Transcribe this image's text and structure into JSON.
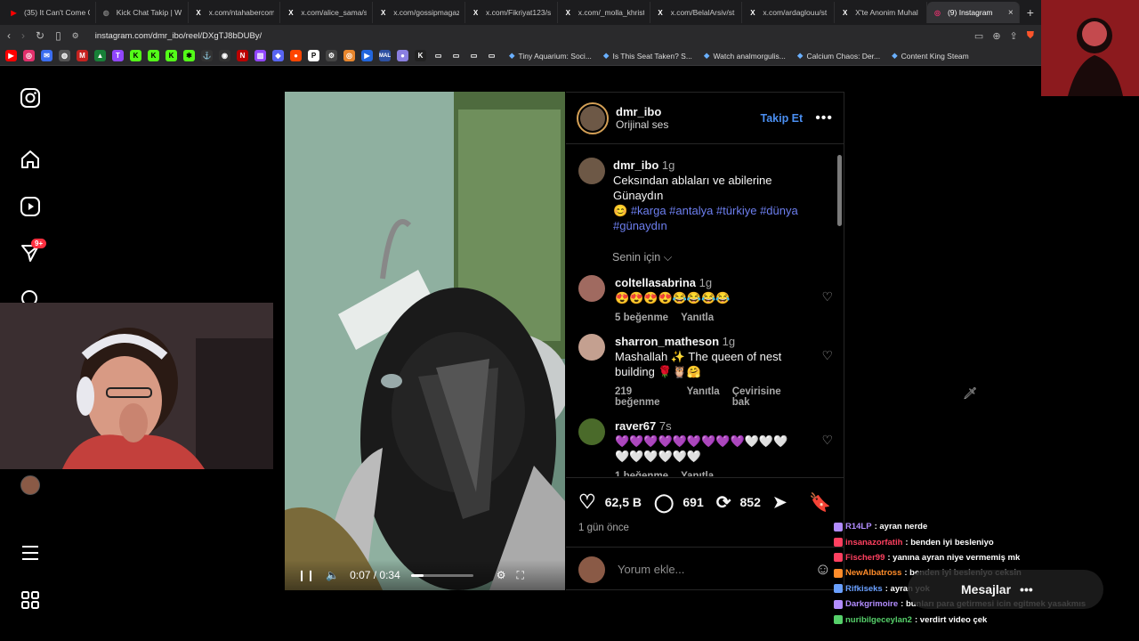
{
  "browser": {
    "tabs": [
      {
        "title": "(35) It Can't Come C",
        "icon": "youtube-icon",
        "color": "#ff0000"
      },
      {
        "title": "Kick Chat Takip | W",
        "icon": "globe-icon",
        "color": "#777777"
      },
      {
        "title": "x.com/ntahabercom",
        "icon": "x-icon",
        "color": "#ffffff"
      },
      {
        "title": "x.com/alice_sama/st",
        "icon": "x-icon",
        "color": "#ffffff"
      },
      {
        "title": "x.com/gossipmagaz",
        "icon": "x-icon",
        "color": "#ffffff"
      },
      {
        "title": "x.com/Fikriyat123/s",
        "icon": "x-icon",
        "color": "#ffffff"
      },
      {
        "title": "x.com/_molla_khrist",
        "icon": "x-icon",
        "color": "#ffffff"
      },
      {
        "title": "x.com/BelalArsiv/st",
        "icon": "x-icon",
        "color": "#ffffff"
      },
      {
        "title": "x.com/ardaglouu/st",
        "icon": "x-icon",
        "color": "#ffffff"
      },
      {
        "title": "X'te Anonim Muhal",
        "icon": "x-icon",
        "color": "#ffffff"
      },
      {
        "title": "(9) Instagram",
        "icon": "instagram-icon",
        "color": "#e1306c",
        "active": true
      }
    ],
    "url": "instagram.com/dmr_ibo/reel/DXgTJ8bDUBy/",
    "bookmarks": [
      "Tiny Aquarium: Soci...",
      "Is This Seat Taken? S...",
      "Watch analmorgulis...",
      "Calcium Chaos: Der...",
      "Content King Steam"
    ]
  },
  "sidebar": {
    "notifications_badge": "9+"
  },
  "video": {
    "time": "0:07 / 0:34",
    "progress": 0.21
  },
  "post": {
    "username": "dmr_ibo",
    "audio": "Orijinal ses",
    "follow_label": "Takip Et",
    "caption_time": "1g",
    "caption_text": "Ceksından ablaları ve abilerine Günaydın",
    "caption_emoji": "😊",
    "hashtags": "#karga #antalya #türkiye #dünya #günaydın",
    "senin_icin": "Senin için",
    "likes": "62,5 B",
    "comments_count": "691",
    "reposts": "852",
    "when": "1 gün önce",
    "comment_placeholder": "Yorum ekle...",
    "comments": [
      {
        "user": "coltellasabrina",
        "time": "1g",
        "text": "😍😍😍😍😂😂😂😂",
        "likes": "5 beğenme",
        "reply": "Yanıtla",
        "extra": ""
      },
      {
        "user": "sharron_matheson",
        "time": "1g",
        "text": "Mashallah ✨ The queen of nest building 🌹🦉🤗",
        "likes": "219 beğenme",
        "reply": "Yanıtla",
        "extra": "Çevirisine bak"
      },
      {
        "user": "raver67",
        "time": "7s",
        "text": "💜💜💜💜💜💜💜💜💜🤍🤍🤍🤍🤍🤍🤍🤍🤍",
        "likes": "1 beğenme",
        "reply": "Yanıtla",
        "extra": ""
      }
    ]
  },
  "chat": {
    "messages_label": "Mesajlar",
    "lines": [
      {
        "user": "R14LP",
        "color": "#b28cff",
        "text": ": ayran nerde"
      },
      {
        "user": "insanazorfatih",
        "color": "#ff4060",
        "text": ": benden iyi besleniyo"
      },
      {
        "user": "Fischer99",
        "color": "#ff4060",
        "text": ": yanına ayran niye vermemiş mk"
      },
      {
        "user": "NewAlbatross",
        "color": "#ff8c2a",
        "text": ": benden iyi besleniyo ceksin"
      },
      {
        "user": "Rifkiseks",
        "color": "#6aa0ff",
        "text": ": ayran yok"
      },
      {
        "user": "Darkgrimoire",
        "color": "#b28cff",
        "text": ": bunları para getirmesi icin egitmek yasakmıs"
      },
      {
        "user": "nuribilgeceylan2",
        "color": "#56d06a",
        "text": ": verdirt video çek"
      }
    ]
  }
}
